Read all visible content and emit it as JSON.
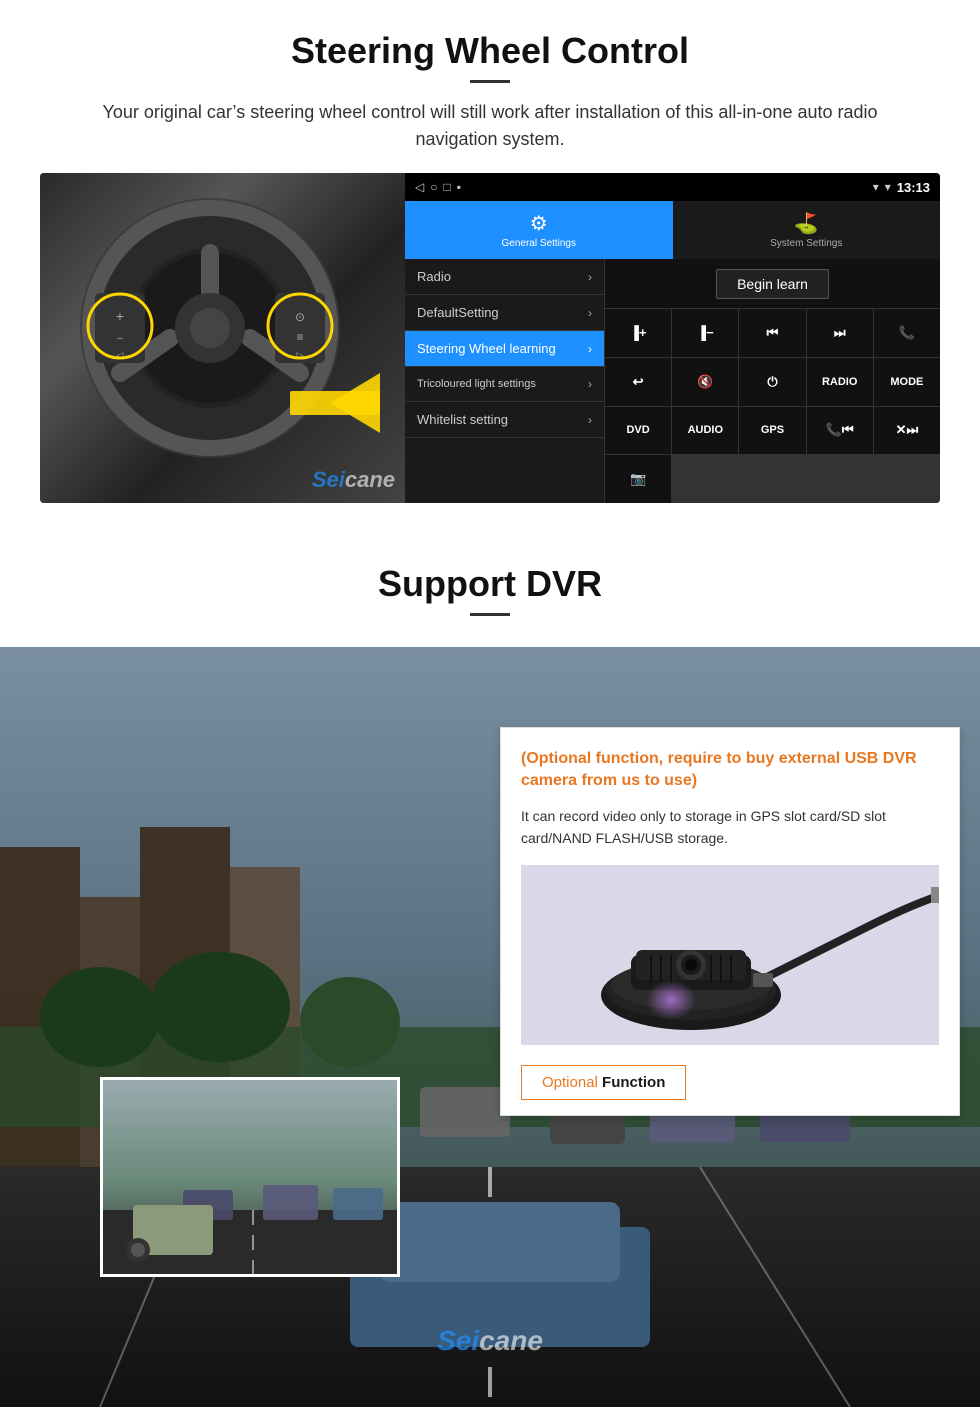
{
  "steering_section": {
    "title": "Steering Wheel Control",
    "subtitle": "Your original car’s steering wheel control will still work after installation of this all-in-one auto radio navigation system.",
    "status_bar": {
      "nav_icons": "◁  ○  □  ■",
      "signal": "▾",
      "wifi": "▾",
      "time": "13:13"
    },
    "tabs": [
      {
        "label": "General Settings",
        "icon": "⚙",
        "active": true
      },
      {
        "label": "System Settings",
        "icon": "⛳",
        "active": false
      }
    ],
    "menu_items": [
      {
        "label": "Radio",
        "active": false
      },
      {
        "label": "DefaultSetting",
        "active": false
      },
      {
        "label": "Steering Wheel learning",
        "active": true
      },
      {
        "label": "Tricoloured light settings",
        "active": false
      },
      {
        "label": "Whitelist setting",
        "active": false
      }
    ],
    "begin_learn_label": "Begin learn",
    "control_buttons": [
      "▏+",
      "▏−",
      "⏮",
      "⏭",
      "☎",
      "←",
      "✖",
      "⏻",
      "RADIO",
      "MODE",
      "DVD",
      "AUDIO",
      "GPS",
      "☎⏮",
      "✕⏭"
    ],
    "watermark": "Seicane"
  },
  "dvr_section": {
    "title": "Support DVR",
    "optional_text": "(Optional function, require to buy external USB DVR camera from us to use)",
    "description": "It can record video only to storage in GPS slot card/SD slot card/NAND FLASH/USB storage.",
    "optional_function_btn": {
      "optional": "Optional",
      "function": "Function"
    },
    "watermark": "Seicane"
  }
}
